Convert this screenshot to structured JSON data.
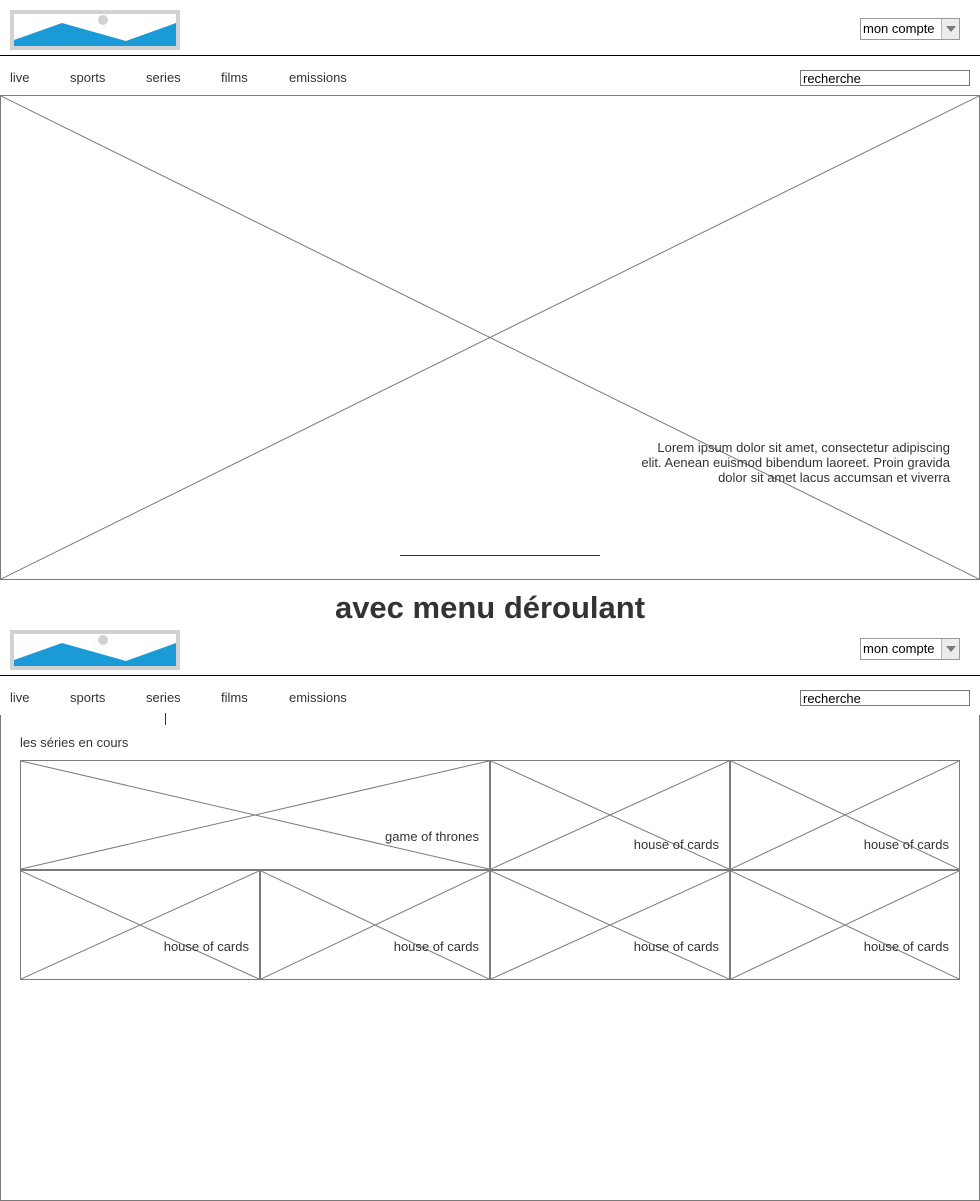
{
  "colors": {
    "logo_frame": "#d2d2d2",
    "logo_mountain": "#1a9ad6",
    "logo_sun": "#d2d2d2",
    "wire_stroke": "#7a7a7a",
    "text": "#333333"
  },
  "icons": {
    "logo": "image-placeholder-icon",
    "dropdown": "triangle-down-icon"
  },
  "header": {
    "account_label": "mon compte",
    "search_placeholder": "recherche"
  },
  "nav": {
    "items": [
      "live",
      "sports",
      "series",
      "films",
      "emissions"
    ]
  },
  "hero": {
    "caption": "Lorem ipsum dolor sit amet, consectetur adipiscing elit. Aenean euismod bibendum laoreet. Proin gravida dolor sit amet lacus accumsan et viverra"
  },
  "section_title": "avec menu déroulant",
  "dropdown_menu": {
    "heading": "les séries en cours",
    "tiles": [
      "game of thrones",
      "house of cards",
      "house of cards",
      "house of cards",
      "house of cards",
      "house of cards",
      "house of cards"
    ]
  }
}
